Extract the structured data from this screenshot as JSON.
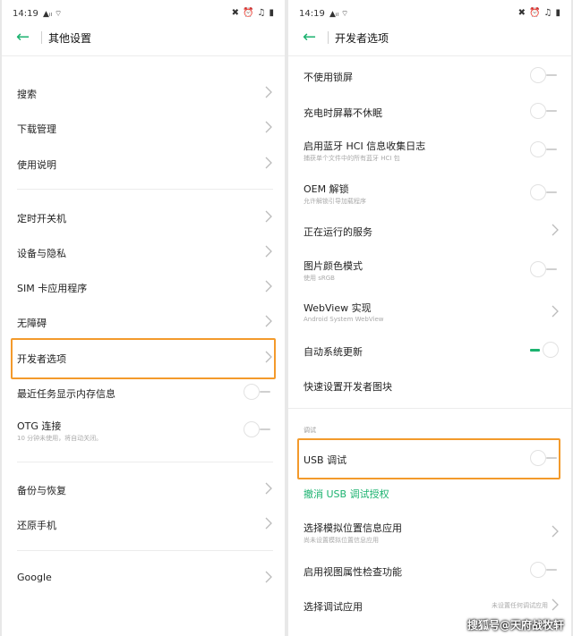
{
  "status": {
    "time": "14:19",
    "signal": "↗▐ ●"
  },
  "left": {
    "title": "其他设置",
    "items": [
      {
        "label": "搜索"
      },
      {
        "label": "下载管理"
      },
      {
        "label": "使用说明"
      },
      {
        "label": "定时开关机"
      },
      {
        "label": "设备与隐私"
      },
      {
        "label": "SIM 卡应用程序"
      },
      {
        "label": "无障碍"
      },
      {
        "label": "开发者选项"
      },
      {
        "label": "最近任务显示内存信息"
      },
      {
        "label": "OTG 连接",
        "sub": "10 分钟未使用，将自动关闭。"
      },
      {
        "label": "备份与恢复"
      },
      {
        "label": "还原手机"
      },
      {
        "label": "Google"
      }
    ]
  },
  "right": {
    "title": "开发者选项",
    "items": [
      {
        "label": "不使用锁屏"
      },
      {
        "label": "充电时屏幕不休眠"
      },
      {
        "label": "启用蓝牙 HCI 信息收集日志",
        "sub": "捕获单个文件中的所有蓝牙 HCI 包"
      },
      {
        "label": "OEM 解锁",
        "sub": "允许解锁引导加载程序"
      },
      {
        "label": "正在运行的服务"
      },
      {
        "label": "图片颜色模式",
        "sub": "使用 sRGB"
      },
      {
        "label": "WebView 实现",
        "sub": "Android System WebView"
      },
      {
        "label": "自动系统更新"
      },
      {
        "label": "快速设置开发者图块"
      },
      {
        "label": "USB 调试"
      },
      {
        "label": "选择模拟位置信息应用",
        "sub": "尚未设置模拟位置信息应用"
      },
      {
        "label": "启用视图属性检查功能"
      },
      {
        "label": "选择调试应用",
        "value": "未设置任何调试应用"
      }
    ],
    "section_debug": "调试",
    "revoke_usb": "撤消 USB 调试授权"
  },
  "watermark": "搜狐号@天府战牧轩",
  "colors": {
    "accent": "#1bb26f",
    "highlight": "#f39a2b"
  }
}
